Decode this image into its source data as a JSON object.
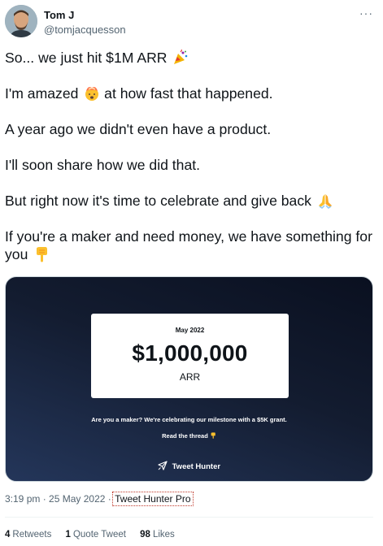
{
  "author": {
    "display_name": "Tom J",
    "handle": "@tomjacquesson"
  },
  "menu": {
    "more_label": "···"
  },
  "tweet": {
    "lines": [
      {
        "text": "So... we just hit $1M ARR",
        "emoji": "party-popper-icon"
      },
      {
        "text_before": "I'm amazed",
        "emoji": "exploding-head-icon",
        "text_after": "at how fast that happened."
      },
      {
        "text": "A year ago we didn't even have a product."
      },
      {
        "text": "I'll soon share how we did that."
      },
      {
        "text": "But right now it's time to celebrate and give back",
        "emoji": "praying-hands-icon"
      },
      {
        "text": "If you're a maker and need money, we have something for you",
        "emoji": "pointing-down-icon"
      }
    ]
  },
  "card": {
    "date": "May 2022",
    "amount": "$1,000,000",
    "metric": "ARR",
    "line1": "Are you a maker? We're celebrating our milestone with a $5K grant.",
    "line2": "Read the thread",
    "line2_emoji": "pointing-down-icon",
    "brand": "Tweet Hunter",
    "brand_icon": "paper-plane-icon"
  },
  "meta": {
    "time": "3:19 pm",
    "separator": "·",
    "date": "25 May 2022",
    "source": "Tweet Hunter Pro"
  },
  "stats": {
    "retweets_count": "4",
    "retweets_label": "Retweets",
    "quotes_count": "1",
    "quotes_label": "Quote Tweet",
    "likes_count": "98",
    "likes_label": "Likes"
  }
}
